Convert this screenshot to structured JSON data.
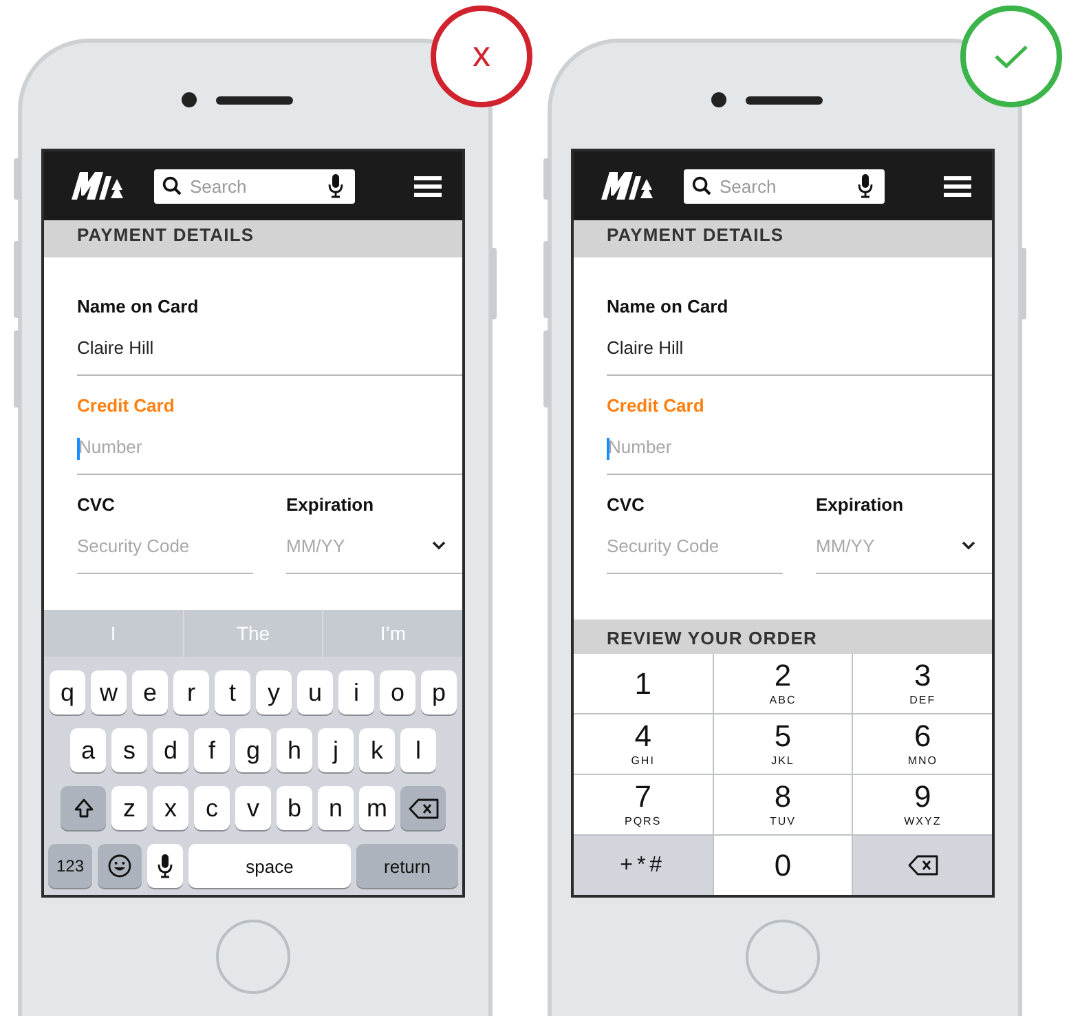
{
  "phones": [
    {
      "badge": {
        "kind": "cross",
        "label": "x",
        "color": "#d0232e"
      },
      "search_placeholder": "Search",
      "payment_title": "PAYMENT DETAILS",
      "fields": [
        {
          "label": "Name on Card",
          "value": "Claire Hill",
          "focused": false
        },
        {
          "label": "Credit Card",
          "placeholder": "Number",
          "focused": true
        }
      ],
      "row_fields": [
        {
          "kind": "text",
          "label": "CVC",
          "placeholder": "Security Code"
        },
        {
          "kind": "select",
          "label": "Expiration",
          "placeholder": "MM/YY"
        }
      ],
      "keyboard": {
        "kind": "alpha",
        "suggestions": [
          "I",
          "The",
          "I’m"
        ],
        "rows": [
          {
            "keys": [
              {
                "kind": "char",
                "label": "q"
              },
              {
                "kind": "char",
                "label": "w"
              },
              {
                "kind": "char",
                "label": "e"
              },
              {
                "kind": "char",
                "label": "r"
              },
              {
                "kind": "char",
                "label": "t"
              },
              {
                "kind": "char",
                "label": "y"
              },
              {
                "kind": "char",
                "label": "u"
              },
              {
                "kind": "char",
                "label": "i"
              },
              {
                "kind": "char",
                "label": "o"
              },
              {
                "kind": "char",
                "label": "p"
              }
            ]
          },
          {
            "keys": [
              {
                "kind": "char",
                "label": "a"
              },
              {
                "kind": "char",
                "label": "s"
              },
              {
                "kind": "char",
                "label": "d"
              },
              {
                "kind": "char",
                "label": "f"
              },
              {
                "kind": "char",
                "label": "g"
              },
              {
                "kind": "char",
                "label": "h"
              },
              {
                "kind": "char",
                "label": "j"
              },
              {
                "kind": "char",
                "label": "k"
              },
              {
                "kind": "char",
                "label": "l"
              }
            ]
          },
          {
            "keys": [
              {
                "kind": "shift"
              },
              {
                "kind": "char",
                "label": "z"
              },
              {
                "kind": "char",
                "label": "x"
              },
              {
                "kind": "char",
                "label": "c"
              },
              {
                "kind": "char",
                "label": "v"
              },
              {
                "kind": "char",
                "label": "b"
              },
              {
                "kind": "char",
                "label": "n"
              },
              {
                "kind": "char",
                "label": "m"
              },
              {
                "kind": "delete"
              }
            ]
          },
          {
            "keys": [
              {
                "kind": "mode",
                "label": "123"
              },
              {
                "kind": "emoji"
              },
              {
                "kind": "mic"
              },
              {
                "kind": "space",
                "label": "space"
              },
              {
                "kind": "mode",
                "label": "return"
              }
            ]
          }
        ]
      }
    },
    {
      "badge": {
        "kind": "check",
        "color": "#3bb54a"
      },
      "search_placeholder": "Search",
      "payment_title": "PAYMENT DETAILS",
      "fields": [
        {
          "label": "Name on Card",
          "value": "Claire Hill",
          "focused": false
        },
        {
          "label": "Credit Card",
          "placeholder": "Number",
          "focused": true
        }
      ],
      "row_fields": [
        {
          "kind": "text",
          "label": "CVC",
          "placeholder": "Security Code"
        },
        {
          "kind": "select",
          "label": "Expiration",
          "placeholder": "MM/YY"
        }
      ],
      "next_section": "REVIEW YOUR ORDER",
      "keyboard": {
        "kind": "numeric",
        "rows": [
          [
            {
              "kind": "digit",
              "label": "1"
            },
            {
              "kind": "digit",
              "label": "2",
              "letters": "ABC"
            },
            {
              "kind": "digit",
              "label": "3",
              "letters": "DEF"
            }
          ],
          [
            {
              "kind": "digit",
              "label": "4",
              "letters": "GHI"
            },
            {
              "kind": "digit",
              "label": "5",
              "letters": "JKL"
            },
            {
              "kind": "digit",
              "label": "6",
              "letters": "MNO"
            }
          ],
          [
            {
              "kind": "digit",
              "label": "7",
              "letters": "PQRS"
            },
            {
              "kind": "digit",
              "label": "8",
              "letters": "TUV"
            },
            {
              "kind": "digit",
              "label": "9",
              "letters": "WXYZ"
            }
          ],
          [
            {
              "kind": "symbols",
              "label": "+*#"
            },
            {
              "kind": "digit",
              "label": "0"
            },
            {
              "kind": "delete"
            }
          ]
        ]
      }
    }
  ]
}
